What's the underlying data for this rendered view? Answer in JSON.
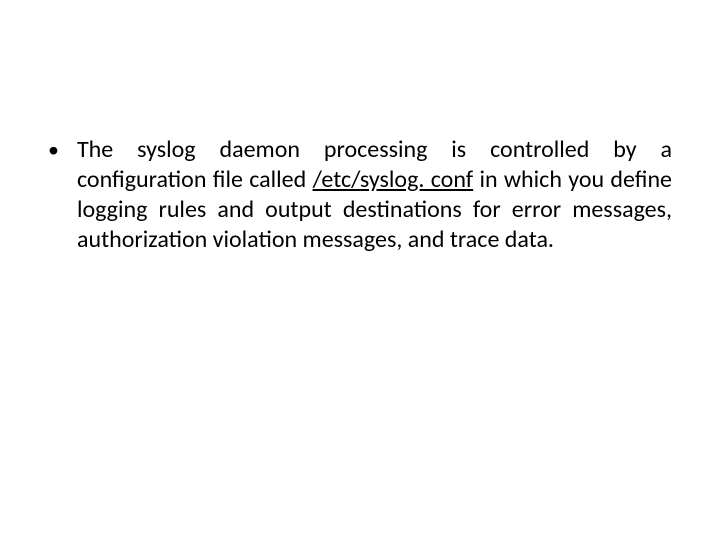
{
  "bullet": {
    "text_before": "The syslog daemon processing is controlled by a configuration file called ",
    "underlined": "/etc/syslog. conf",
    "text_after": " in which you define logging rules and output destinations for error messages, authorization violation messages, and trace data."
  }
}
